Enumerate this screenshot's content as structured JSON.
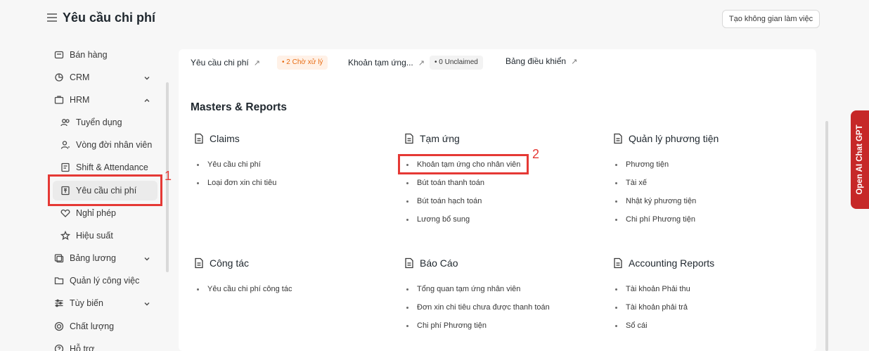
{
  "header": {
    "title": "Yêu cầu chi phí",
    "workspace_button": "Tạo không gian làm việc"
  },
  "sidebar": {
    "items": [
      {
        "label": "Bán hàng",
        "icon": "sales-icon"
      },
      {
        "label": "CRM",
        "icon": "crm-icon"
      },
      {
        "label": "HRM",
        "icon": "hrm-icon"
      },
      {
        "label": "Tuyển dụng",
        "icon": "recruit-icon"
      },
      {
        "label": "Vòng đời nhân viên",
        "icon": "employee-lifecycle-icon"
      },
      {
        "label": "Shift & Attendance",
        "icon": "attendance-icon"
      },
      {
        "label": "Yêu cầu chi phí",
        "icon": "expense-icon"
      },
      {
        "label": "Nghỉ phép",
        "icon": "leave-icon"
      },
      {
        "label": "Hiệu suất",
        "icon": "star-icon"
      },
      {
        "label": "Bảng lương",
        "icon": "payroll-icon"
      },
      {
        "label": "Quản lý công việc",
        "icon": "folder-icon"
      },
      {
        "label": "Tùy biến",
        "icon": "sliders-icon"
      },
      {
        "label": "Chất lượng",
        "icon": "quality-icon"
      },
      {
        "label": "Hỗ trợ",
        "icon": "support-icon"
      }
    ]
  },
  "shortcuts": {
    "s1": "Yêu cầu chi phí",
    "s1_badge": "2 Chờ xử lý",
    "s2": "Khoản tạm ứng...",
    "s2_badge": "0 Unclaimed",
    "s3": "Bảng điều khiển",
    "arrow": "↗"
  },
  "main": {
    "section_title": "Masters & Reports",
    "groups": [
      {
        "title": "Claims",
        "links": [
          "Yêu cầu chi phí",
          "Loại đơn xin chi tiêu"
        ]
      },
      {
        "title": "Tạm ứng",
        "links": [
          "Khoản tạm ứng cho nhân viên",
          "Bút toán thanh toán",
          "Bút toán hạch toán",
          "Lương bổ sung"
        ]
      },
      {
        "title": "Quản lý phương tiện",
        "links": [
          "Phương tiện",
          "Tài xế",
          "Nhật ký phương tiện",
          "Chi phí Phương tiện"
        ]
      },
      {
        "title": "Công tác",
        "links": [
          "Yêu cầu chi phí công tác"
        ]
      },
      {
        "title": "Báo Cáo",
        "links": [
          "Tổng quan tạm ứng nhân viên",
          "Đơn xin chi tiêu chưa được thanh toán",
          "Chi phí Phương tiện"
        ]
      },
      {
        "title": "Accounting Reports",
        "links": [
          "Tài khoản Phải thu",
          "Tài khoản phải trả",
          "Sổ cái"
        ]
      }
    ]
  },
  "annotations": {
    "mark1": "1",
    "mark2": "2"
  },
  "gpt_tab": "Open AI Chat GPT",
  "colors": {
    "accent_red": "#e53935",
    "badge_orange": "#e86c13",
    "gpt_tab": "#c62828"
  }
}
